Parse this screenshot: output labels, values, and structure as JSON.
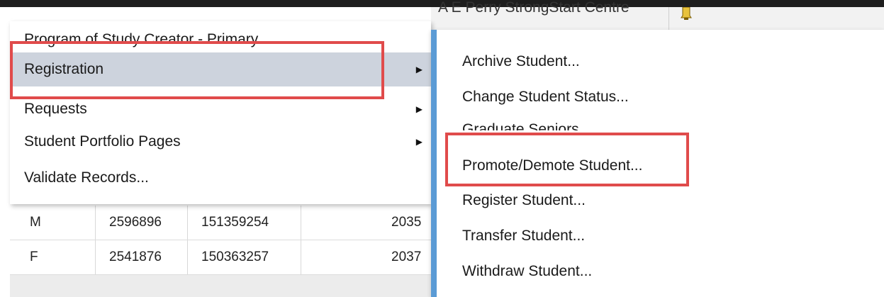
{
  "background": {
    "top_row": {
      "cell_text": "A E Perry StrongStart Centre",
      "icon": "bell-icon"
    },
    "table_rows": [
      {
        "gender": "M",
        "id": "2596896",
        "number": "151359254",
        "year": "2035"
      },
      {
        "gender": "F",
        "id": "2541876",
        "number": "150363257",
        "year": "2037"
      }
    ]
  },
  "menu": {
    "items": [
      {
        "label": "Program of Study Creator - Primary",
        "has_submenu": false
      },
      {
        "label": "Registration",
        "has_submenu": true,
        "highlighted": true
      },
      {
        "label": "Requests",
        "has_submenu": true
      },
      {
        "label": "Student Portfolio Pages",
        "has_submenu": true
      },
      {
        "label": "Validate Records...",
        "has_submenu": false
      }
    ],
    "submenu_arrow": "▶"
  },
  "submenu": {
    "items": [
      {
        "label": "Archive Student..."
      },
      {
        "label": "Change Student Status..."
      },
      {
        "label": "Graduate Seniors..."
      },
      {
        "label": "Promote/Demote Student..."
      },
      {
        "label": "Register Student..."
      },
      {
        "label": "Transfer Student..."
      },
      {
        "label": "Withdraw Student..."
      }
    ]
  },
  "colors": {
    "highlight": "#cdd3dd",
    "annotation_red": "#e04b4b",
    "submenu_accent": "#5b9bd5"
  }
}
